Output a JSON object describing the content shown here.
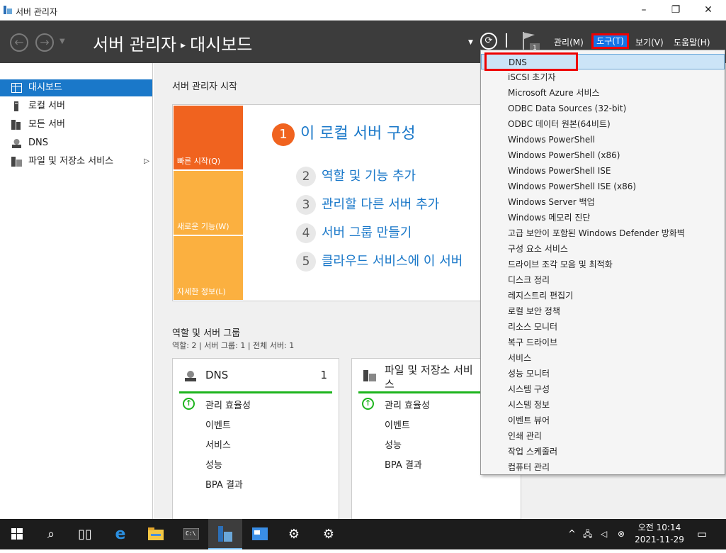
{
  "window": {
    "title": "서버 관리자",
    "minimize": "–",
    "restore": "❐",
    "close": "✕"
  },
  "header": {
    "breadcrumb_root": "서버 관리자",
    "breadcrumb_sep": "▸",
    "breadcrumb_current": "대시보드",
    "menu": {
      "manage": "관리(M)",
      "tools": "도구(T)",
      "view": "보기(V)",
      "help": "도움말(H)"
    },
    "flag_badge": "1"
  },
  "sidebar": {
    "items": [
      {
        "label": "대시보드",
        "icon": "dashboard-icon"
      },
      {
        "label": "로컬 서버",
        "icon": "local-server-icon"
      },
      {
        "label": "모든 서버",
        "icon": "all-servers-icon"
      },
      {
        "label": "DNS",
        "icon": "dns-icon"
      },
      {
        "label": "파일 및 저장소 서비스",
        "icon": "file-storage-icon",
        "arrow": "▷"
      }
    ]
  },
  "main": {
    "welcome_title": "서버 관리자 시작",
    "tiles": {
      "quick_start": "빠른 시작(Q)",
      "new_features": "새로운 기능(W)",
      "learn_more": "자세한 정보(L)"
    },
    "steps": [
      {
        "num": "1",
        "label": "이 로컬 서버 구성"
      },
      {
        "num": "2",
        "label": "역할 및 기능 추가"
      },
      {
        "num": "3",
        "label": "관리할 다른 서버 추가"
      },
      {
        "num": "4",
        "label": "서버 그룹 만들기"
      },
      {
        "num": "5",
        "label": "클라우드 서비스에 이 서버"
      }
    ],
    "roles_title": "역할 및 서버 그룹",
    "roles_summary": "역할: 2   |   서버 그룹: 1   |   전체 서버: 1",
    "cards": [
      {
        "title": "DNS",
        "count": "1",
        "rows": [
          "관리 효율성",
          "이벤트",
          "서비스",
          "성능",
          "BPA 결과"
        ]
      },
      {
        "title": "파일 및 저장소 서비\n스",
        "count": "",
        "rows": [
          "관리 효율성",
          "이벤트",
          "성능",
          "BPA 결과"
        ]
      }
    ]
  },
  "tools_menu": [
    "DNS",
    "iSCSI 초기자",
    "Microsoft Azure 서비스",
    "ODBC Data Sources (32-bit)",
    "ODBC 데이터 원본(64비트)",
    "Windows PowerShell",
    "Windows PowerShell (x86)",
    "Windows PowerShell ISE",
    "Windows PowerShell ISE (x86)",
    "Windows Server 백업",
    "Windows 메모리 진단",
    "고급 보안이 포함된 Windows Defender 방화벽",
    "구성 요소 서비스",
    "드라이브 조각 모음 및 최적화",
    "디스크 정리",
    "레지스트리 편집기",
    "로컬 보안 정책",
    "리소스 모니터",
    "복구 드라이브",
    "서비스",
    "성능 모니터",
    "시스템 구성",
    "시스템 정보",
    "이벤트 뷰어",
    "인쇄 관리",
    "작업 스케줄러",
    "컴퓨터 관리"
  ],
  "taskbar": {
    "time": "오전 10:14",
    "date": "2021-11-29",
    "tray_up": "^"
  },
  "colors": {
    "accent": "#1a78c9",
    "header": "#3c3c3c",
    "quick_start": "#f0631f",
    "tile": "#fbb040",
    "ok": "#1db41d",
    "highlight": "#e00"
  }
}
